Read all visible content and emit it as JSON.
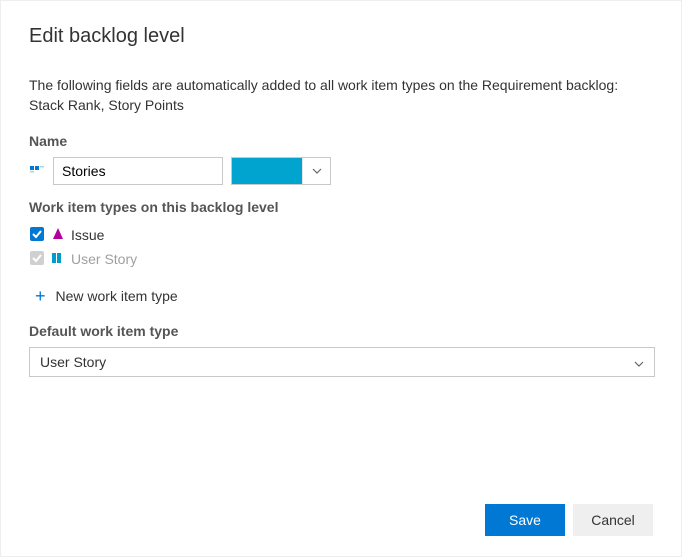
{
  "title": "Edit backlog level",
  "description": "The following fields are automatically added to all work item types on the Requirement backlog: Stack Rank, Story Points",
  "name": {
    "label": "Name",
    "value": "Stories",
    "color": "#00a4cf"
  },
  "workItemTypes": {
    "label": "Work item types on this backlog level",
    "items": [
      {
        "label": "Issue",
        "checked": true,
        "enabled": true,
        "iconColor": "#b4009e"
      },
      {
        "label": "User Story",
        "checked": true,
        "enabled": false,
        "iconColor": "#009ccc"
      }
    ],
    "newLabel": "New work item type"
  },
  "defaultType": {
    "label": "Default work item type",
    "selected": "User Story"
  },
  "buttons": {
    "save": "Save",
    "cancel": "Cancel"
  }
}
